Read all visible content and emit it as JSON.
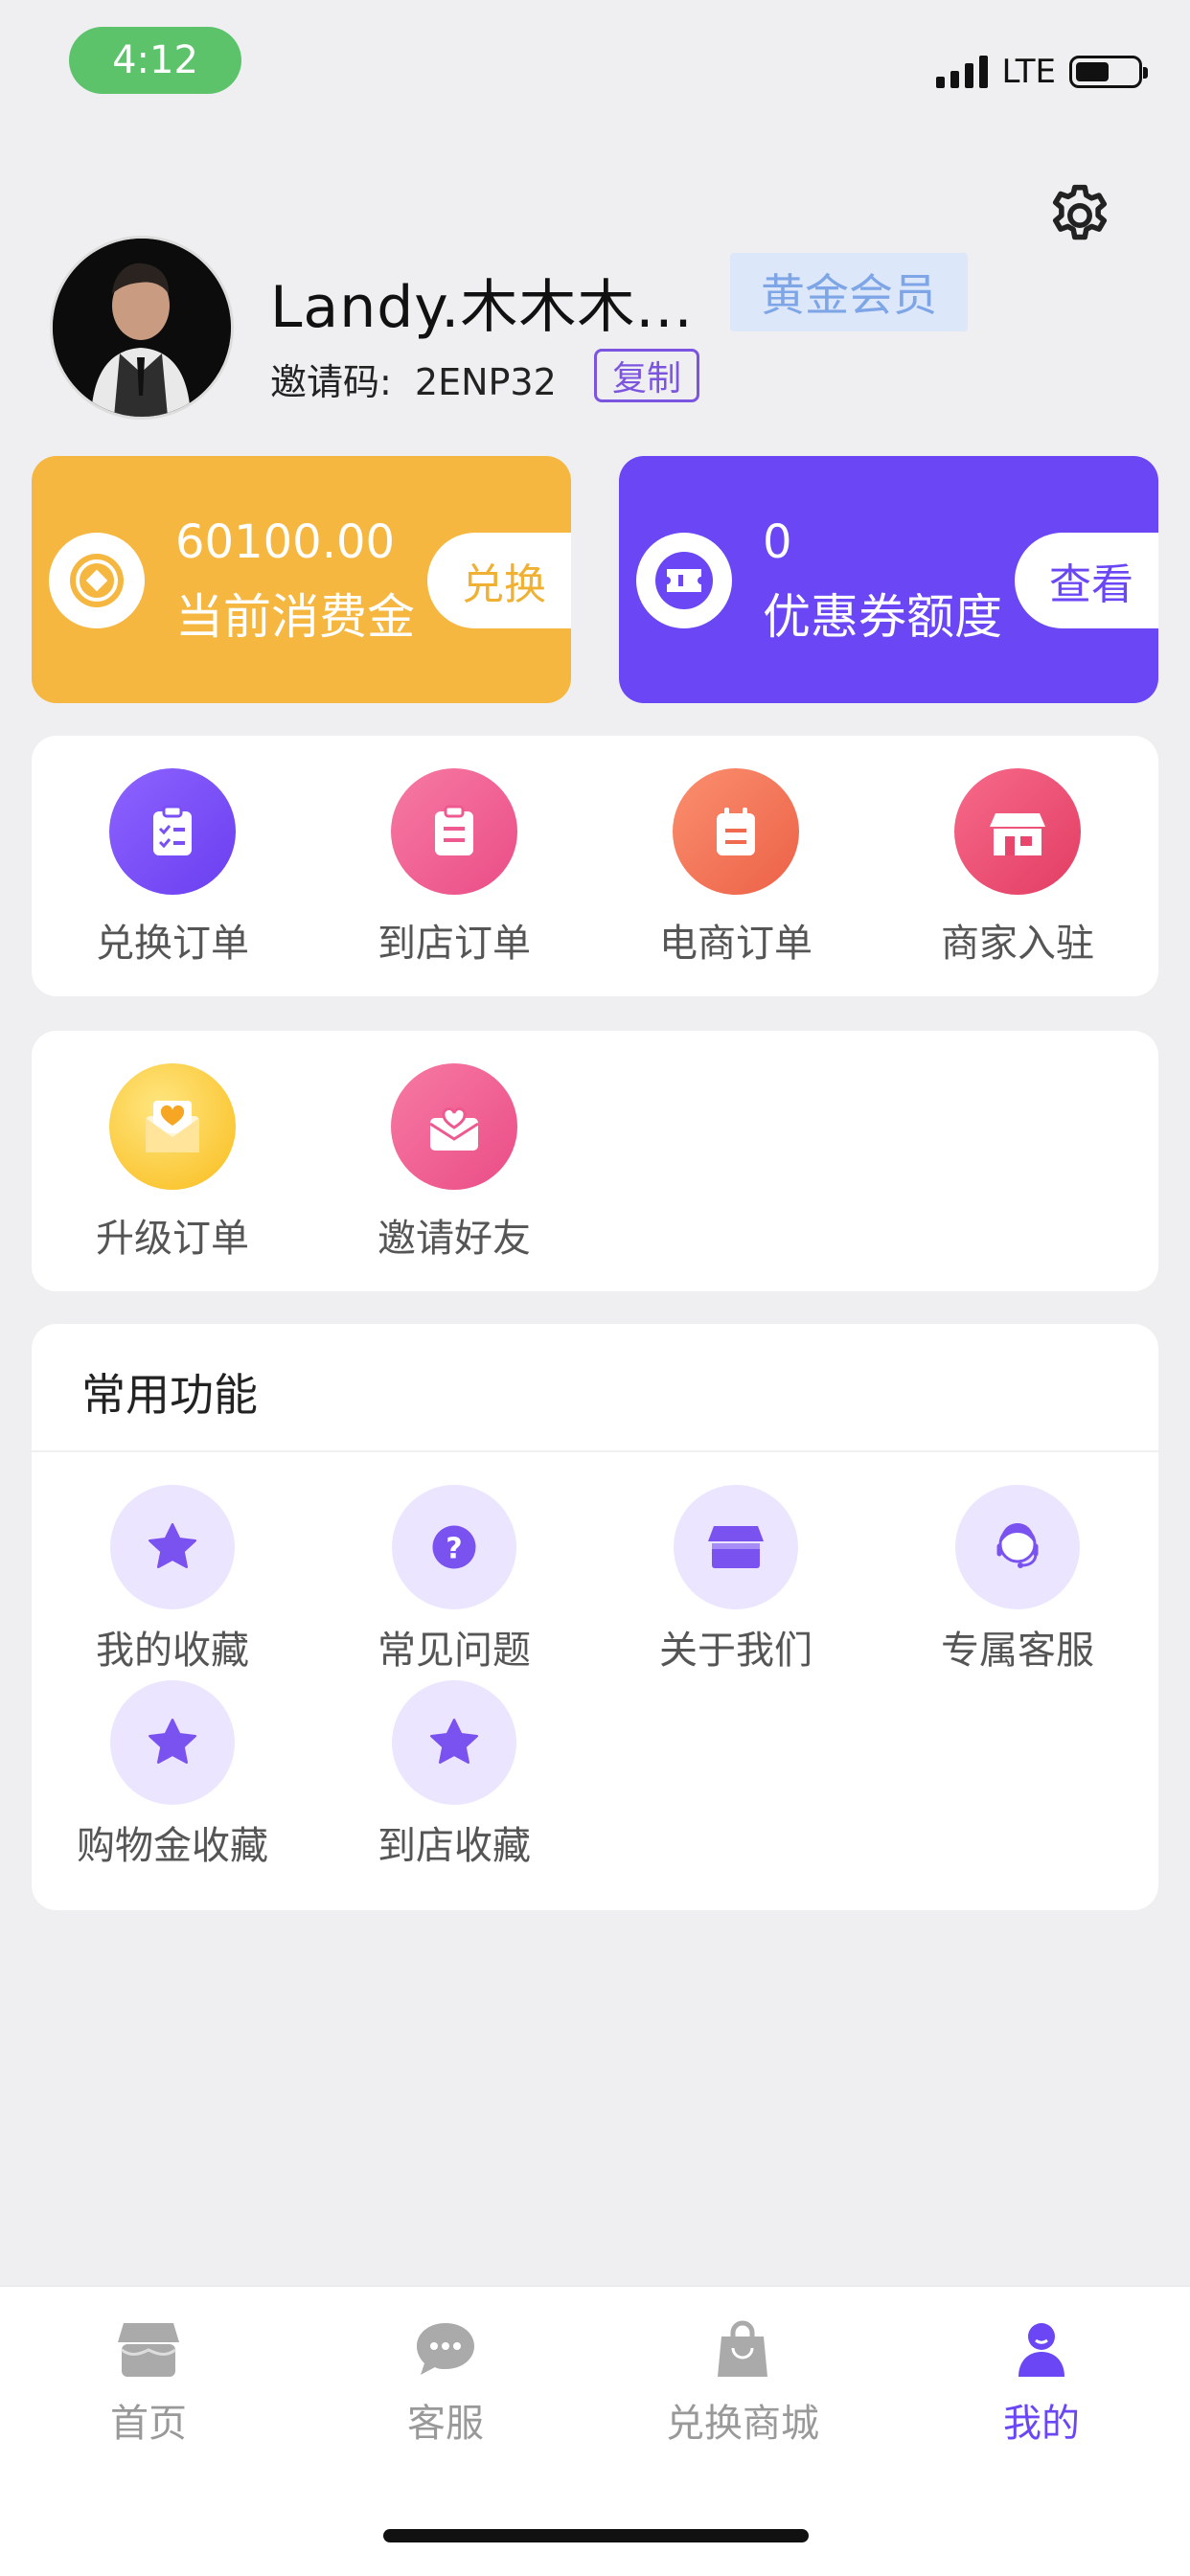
{
  "status_bar": {
    "time": "4:12",
    "network": "LTE",
    "battery_level": 0.55
  },
  "profile": {
    "username": "Landy.木木木...",
    "member_level": "黄金会员",
    "invite_label": "邀请码:",
    "invite_code": "2ENP32",
    "copy_label": "复制"
  },
  "cards": {
    "balance": {
      "value": "60100.00",
      "label": "当前消费金",
      "button": "兑换",
      "color": "#f5b740"
    },
    "coupon": {
      "value": "0",
      "label": "优惠券额度",
      "button": "查看",
      "color": "#6a46f4"
    }
  },
  "orders": [
    {
      "label": "兑换订单",
      "icon": "clipboard-check-icon"
    },
    {
      "label": "到店订单",
      "icon": "clipboard-icon"
    },
    {
      "label": "电商订单",
      "icon": "calendar-clipboard-icon"
    },
    {
      "label": "商家入驻",
      "icon": "store-icon"
    }
  ],
  "extras": [
    {
      "label": "升级订单",
      "icon": "heart-envelope-icon"
    },
    {
      "label": "邀请好友",
      "icon": "heart-mail-icon"
    }
  ],
  "functions": {
    "title": "常用功能",
    "items": [
      {
        "label": "我的收藏",
        "icon": "star-icon"
      },
      {
        "label": "常见问题",
        "icon": "question-icon"
      },
      {
        "label": "关于我们",
        "icon": "shop-icon"
      },
      {
        "label": "专属客服",
        "icon": "customer-service-icon"
      },
      {
        "label": "购物金收藏",
        "icon": "star-icon"
      },
      {
        "label": "到店收藏",
        "icon": "star-icon"
      }
    ]
  },
  "tabbar": {
    "items": [
      {
        "label": "首页",
        "icon": "home-store-icon"
      },
      {
        "label": "客服",
        "icon": "chat-bubble-icon"
      },
      {
        "label": "兑换商城",
        "icon": "shopping-bag-icon"
      },
      {
        "label": "我的",
        "icon": "user-icon"
      }
    ],
    "active_index": 3,
    "active_color": "#6a46f4"
  }
}
